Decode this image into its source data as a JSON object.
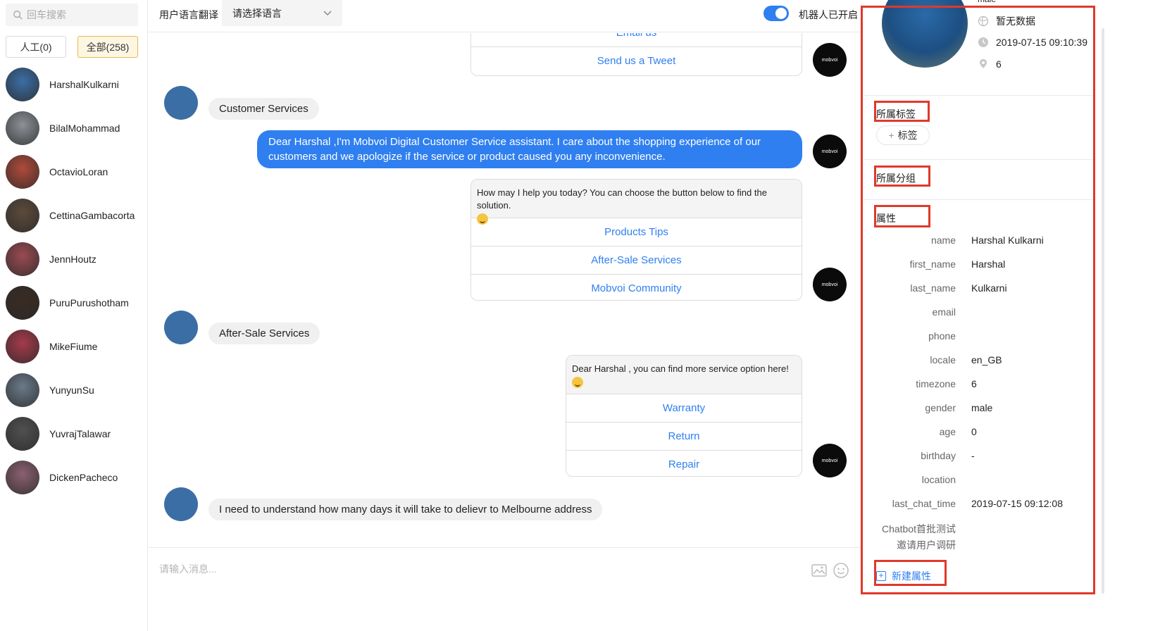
{
  "sidebar": {
    "search_placeholder": "回车搜索",
    "filters": [
      {
        "label": "人工(0)"
      },
      {
        "label": "全部(258)"
      }
    ],
    "contacts": [
      {
        "name": "HarshalKulkarni",
        "color": "#3b6ea5"
      },
      {
        "name": "BilalMohammad",
        "color": "#8d9298"
      },
      {
        "name": "OctavioLoran",
        "color": "#b04a3a"
      },
      {
        "name": "CettinaGambacorta",
        "color": "#5b4a3a"
      },
      {
        "name": "JennHoutz",
        "color": "#9a4a52"
      },
      {
        "name": "PuruPurushotham",
        "color": "#3a2b22"
      },
      {
        "name": "MikeFiume",
        "color": "#a63a4a"
      },
      {
        "name": "YunyunSu",
        "color": "#6a7a8a"
      },
      {
        "name": "YuvrajTalawar",
        "color": "#505050"
      },
      {
        "name": "DickenPacheco",
        "color": "#8a6070"
      }
    ]
  },
  "topbar": {
    "translate_label": "用户语言翻译",
    "language_select": "请选择语言",
    "bot_status": "机器人已开启"
  },
  "chat": {
    "card0_buttons": [
      "Email us",
      "Send us a Tweet"
    ],
    "user_msg_1": "Customer Services",
    "bot_msg_1": "Dear Harshal ,I'm Mobvoi Digital Customer Service assistant. I care about the shopping experience of our customers and we apologize if the service or product caused you any inconvenience.",
    "bot_msg_2_text": "How may I help you today? You can choose the button below to find the solution.",
    "bot_msg_2_buttons": [
      "Products Tips",
      "After-Sale Services",
      "Mobvoi Community"
    ],
    "user_msg_2": "After-Sale Services",
    "bot_msg_3_text": "Dear Harshal , you can find more service option here!",
    "bot_msg_3_buttons": [
      "Warranty",
      "Return",
      "Repair"
    ],
    "user_msg_3": "I need to understand how many days it will take to delievr  to Melbourne address",
    "bot_avatar_text": "mobvoi"
  },
  "input": {
    "placeholder": "请输入消息..."
  },
  "profile": {
    "gender_top": "male",
    "location_info": "暂无数据",
    "time_info": "2019-07-15 09:10:39",
    "visits": "6",
    "tags_title": "所属标签",
    "add_tag": "标签",
    "group_title": "所属分组",
    "attrs_title": "属性",
    "attributes": [
      {
        "key": "name",
        "value": "Harshal Kulkarni"
      },
      {
        "key": "first_name",
        "value": "Harshal"
      },
      {
        "key": "last_name",
        "value": "Kulkarni"
      },
      {
        "key": "email",
        "value": ""
      },
      {
        "key": "phone",
        "value": ""
      },
      {
        "key": "locale",
        "value": "en_GB"
      },
      {
        "key": "timezone",
        "value": "6"
      },
      {
        "key": "gender",
        "value": "male"
      },
      {
        "key": "age",
        "value": "0"
      },
      {
        "key": "birthday",
        "value": "-"
      },
      {
        "key": "location",
        "value": ""
      },
      {
        "key": "last_chat_time",
        "value": "2019-07-15 09:12:08"
      },
      {
        "key": "Chatbot首批测试",
        "value": ""
      },
      {
        "key": "邀请用户调研",
        "value": ""
      }
    ],
    "new_attr": "新建属性",
    "highlight_color": "#e0392b"
  }
}
